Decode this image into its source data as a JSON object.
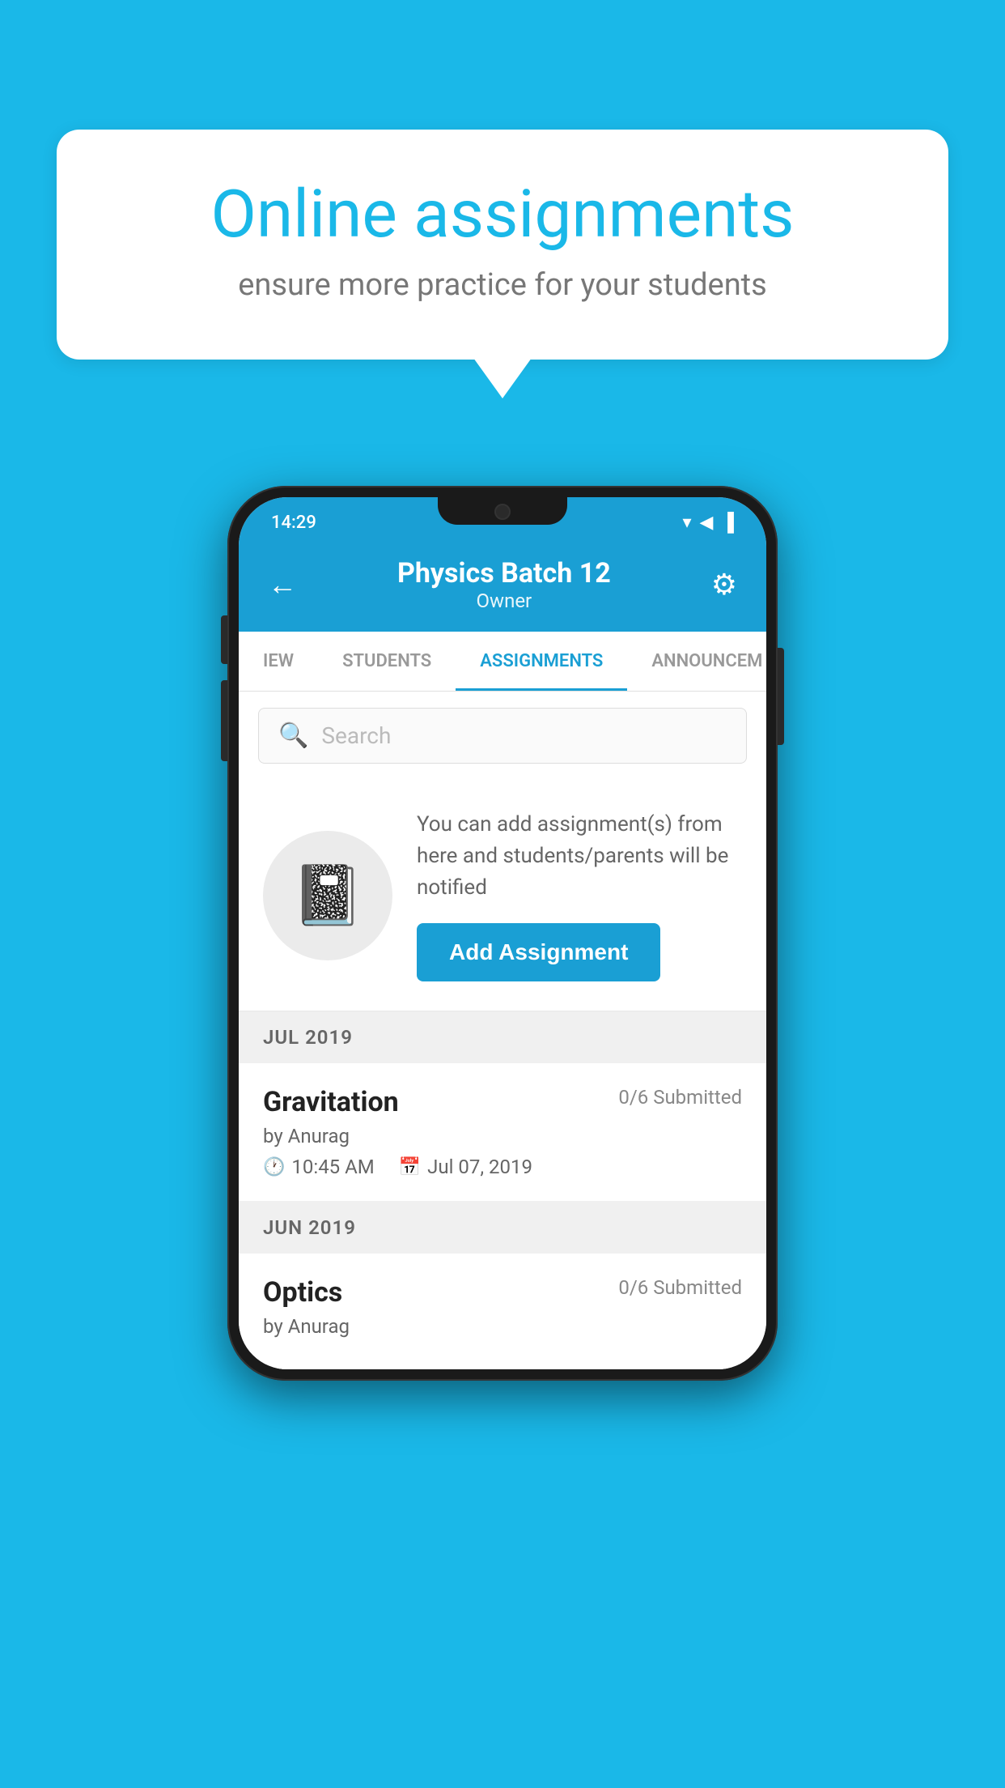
{
  "background_color": "#1ab8e8",
  "bubble": {
    "title": "Online assignments",
    "subtitle": "ensure more practice for your students"
  },
  "status_bar": {
    "time": "14:29",
    "wifi": "▼",
    "signal": "◀",
    "battery": "▐"
  },
  "header": {
    "title": "Physics Batch 12",
    "subtitle": "Owner",
    "back_label": "←",
    "settings_label": "⚙"
  },
  "tabs": [
    {
      "label": "IEW",
      "active": false
    },
    {
      "label": "STUDENTS",
      "active": false
    },
    {
      "label": "ASSIGNMENTS",
      "active": true
    },
    {
      "label": "ANNOUNCEM",
      "active": false
    }
  ],
  "search": {
    "placeholder": "Search"
  },
  "add_assignment_card": {
    "description": "You can add assignment(s) from here and students/parents will be notified",
    "button_label": "Add Assignment"
  },
  "sections": [
    {
      "label": "JUL 2019",
      "assignments": [
        {
          "name": "Gravitation",
          "submitted": "0/6 Submitted",
          "by": "by Anurag",
          "time": "10:45 AM",
          "date": "Jul 07, 2019"
        }
      ]
    },
    {
      "label": "JUN 2019",
      "assignments": [
        {
          "name": "Optics",
          "submitted": "0/6 Submitted",
          "by": "by Anurag",
          "time": "",
          "date": ""
        }
      ]
    }
  ],
  "icons": {
    "search": "🔍",
    "notebook": "📓",
    "clock": "🕐",
    "calendar": "📅"
  }
}
